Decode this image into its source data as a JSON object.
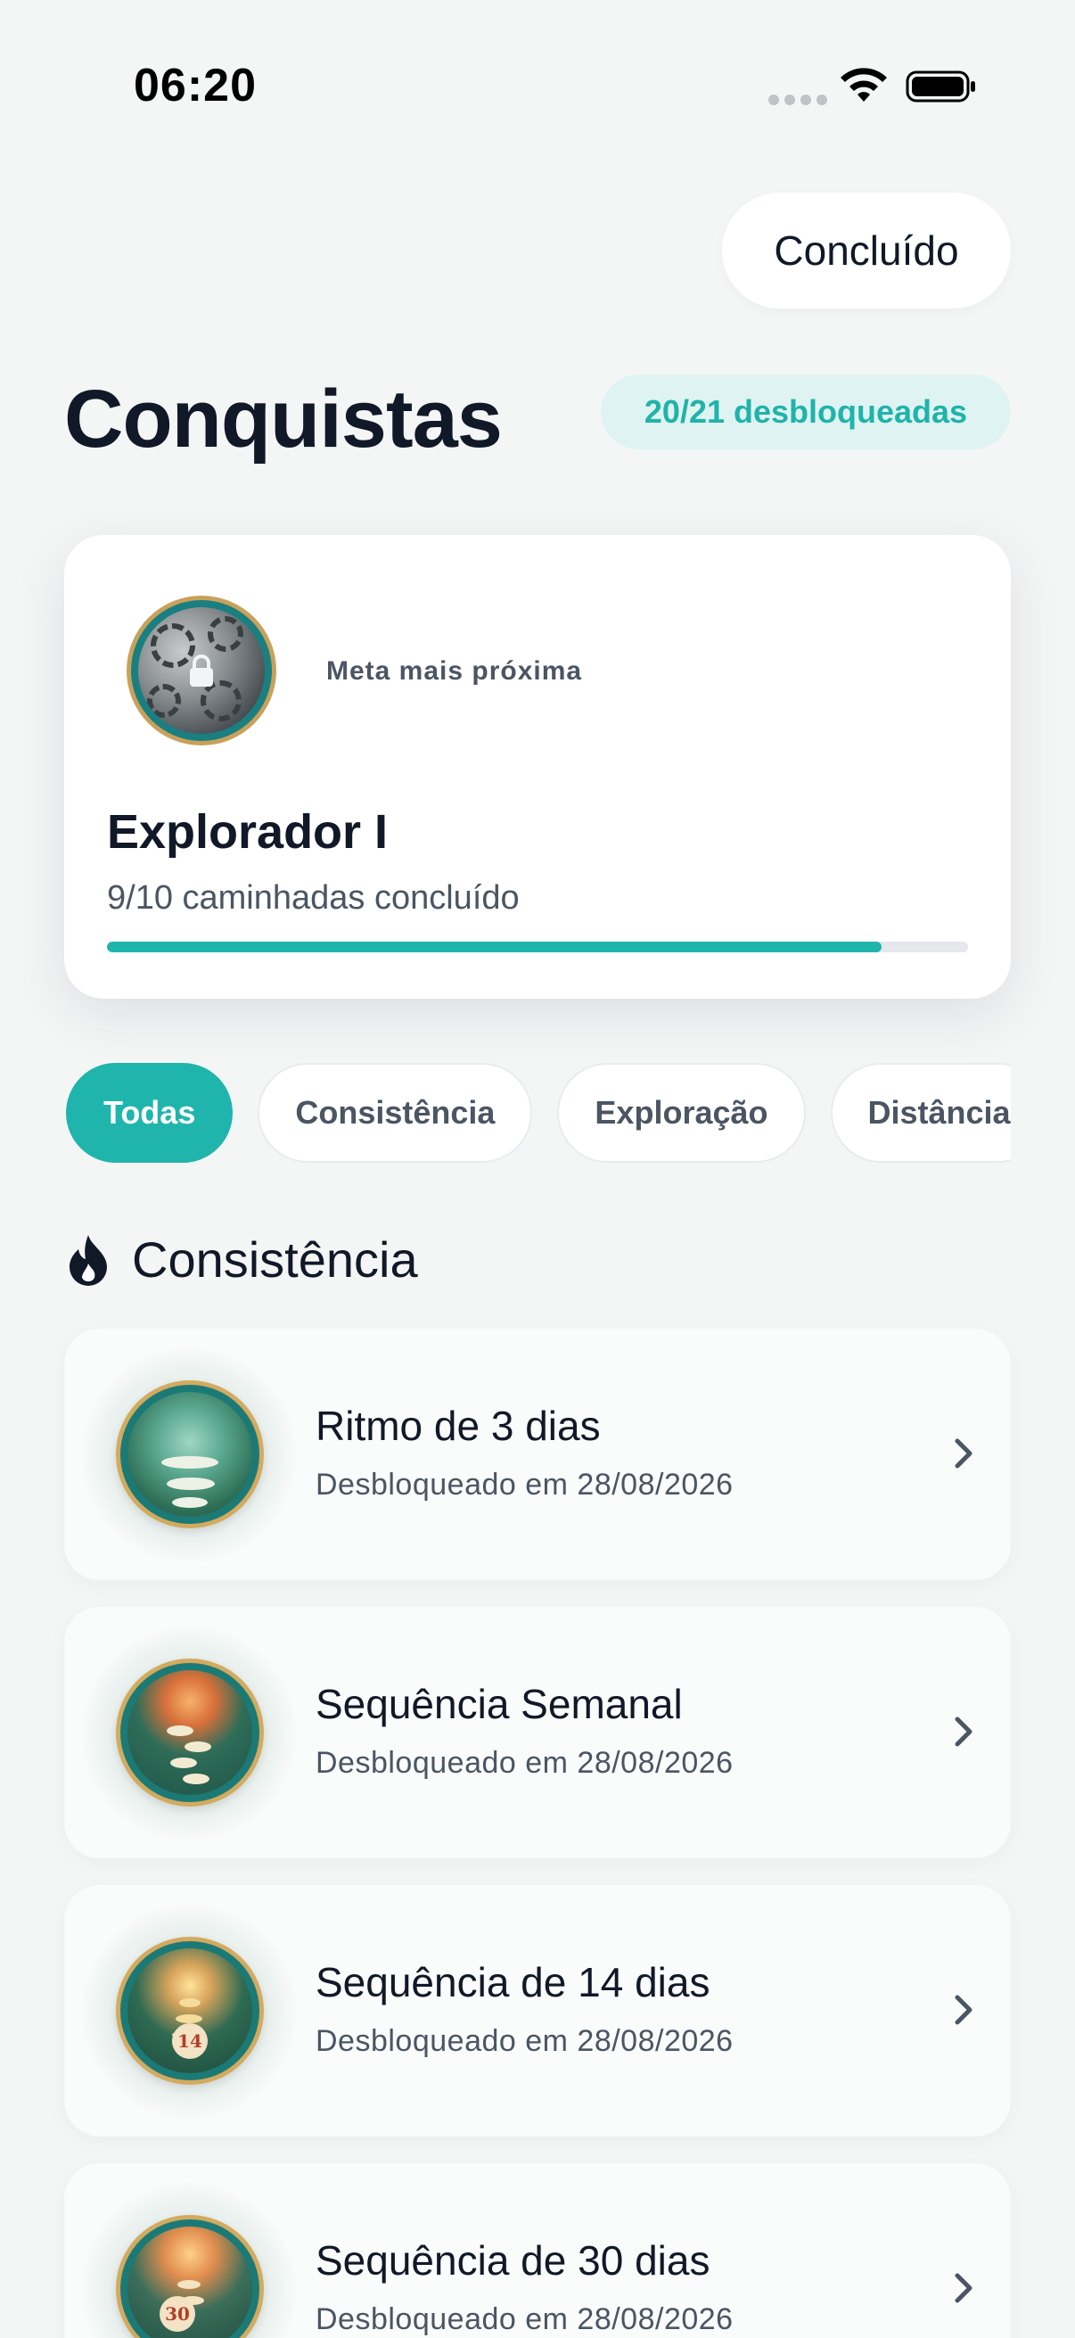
{
  "status_bar": {
    "time": "06:20"
  },
  "header": {
    "done_label": "Concluído"
  },
  "page": {
    "title": "Conquistas",
    "unlocked_badge": "20/21 desbloqueadas"
  },
  "next_goal": {
    "eyebrow": "Meta mais próxima",
    "name": "Explorador I",
    "progress_text": "9/10 caminhadas concluído",
    "progress_fraction": 0.9,
    "icon": "lock-icon"
  },
  "filters": [
    {
      "label": "Todas",
      "active": true
    },
    {
      "label": "Consistência",
      "active": false
    },
    {
      "label": "Exploração",
      "active": false
    },
    {
      "label": "Distância",
      "active": false
    }
  ],
  "section": {
    "title": "Consistência",
    "icon": "flame-icon"
  },
  "achievements": [
    {
      "title": "Ritmo de 3 dias",
      "subtitle": "Desbloqueado em 28/08/2026",
      "badge_number": ""
    },
    {
      "title": "Sequência Semanal",
      "subtitle": "Desbloqueado em 28/08/2026",
      "badge_number": ""
    },
    {
      "title": "Sequência de 14 dias",
      "subtitle": "Desbloqueado em 28/08/2026",
      "badge_number": "14"
    },
    {
      "title": "Sequência de 30 dias",
      "subtitle": "Desbloqueado em 28/08/2026",
      "badge_number": "30"
    }
  ],
  "colors": {
    "accent": "#1fb5ad",
    "badge_bg": "#dff4f2",
    "text": "#111827",
    "muted": "#4b5563"
  }
}
